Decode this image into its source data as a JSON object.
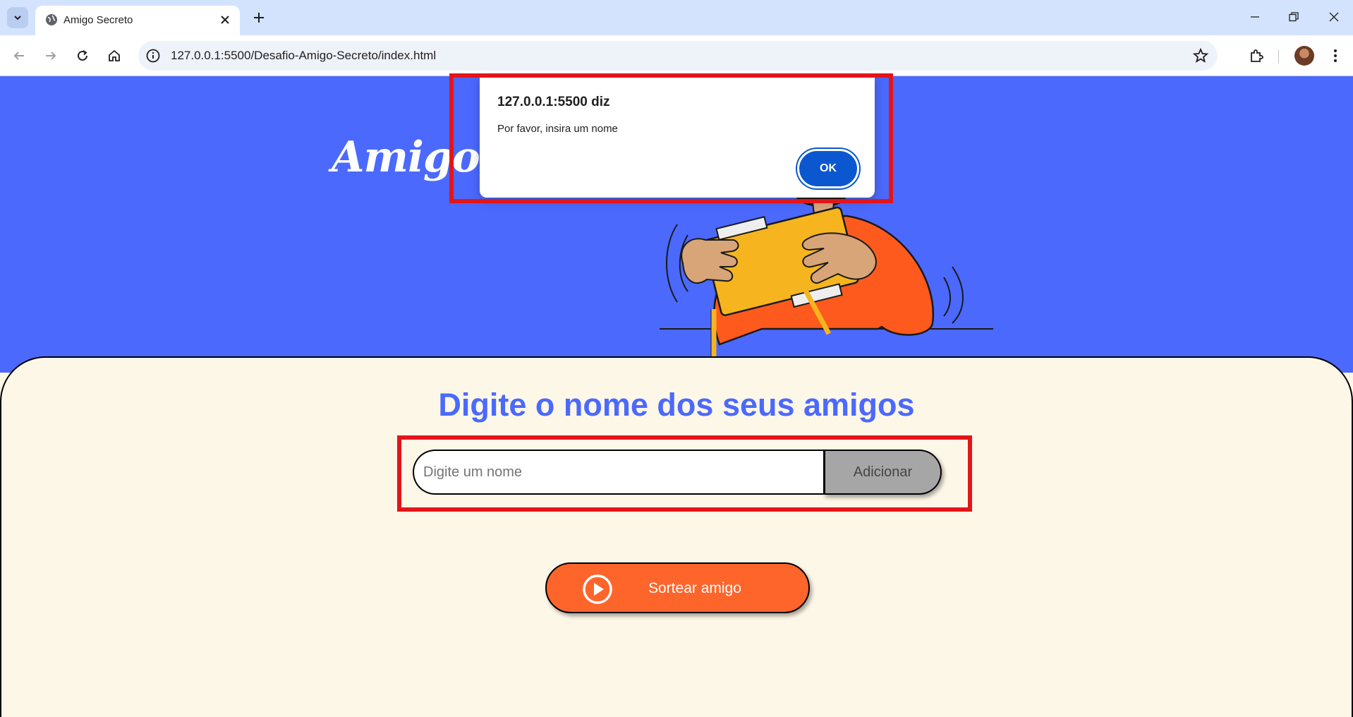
{
  "browser": {
    "tab_title": "Amigo Secreto",
    "url": "127.0.0.1:5500/Desafio-Amigo-Secreto/index.html"
  },
  "page": {
    "title": "Amigo Secreto",
    "section_title": "Digite o nome dos seus amigos",
    "name_input": {
      "value": "",
      "placeholder": "Digite um nome"
    },
    "add_button_label": "Adicionar",
    "draw_button_label": "Sortear amigo"
  },
  "dialog": {
    "origin": "127.0.0.1:5500 diz",
    "message": "Por favor, insira um nome",
    "ok_label": "OK"
  },
  "colors": {
    "hero_blue": "#4b69fd",
    "panel_cream": "#fdf7e8",
    "draw_orange": "#fe652b",
    "add_gray": "#a6a6a6",
    "dialog_button_blue": "#0b57d0",
    "annotation_red": "#e3151a"
  },
  "icons": [
    "tab-search-icon",
    "globe-icon",
    "close-icon",
    "plus-icon",
    "minimize-icon",
    "restore-icon",
    "window-close-icon",
    "back-arrow-icon",
    "forward-arrow-icon",
    "reload-icon",
    "home-icon",
    "site-info-icon",
    "star-icon",
    "extensions-icon",
    "more-vert-icon",
    "play-circle-icon"
  ]
}
